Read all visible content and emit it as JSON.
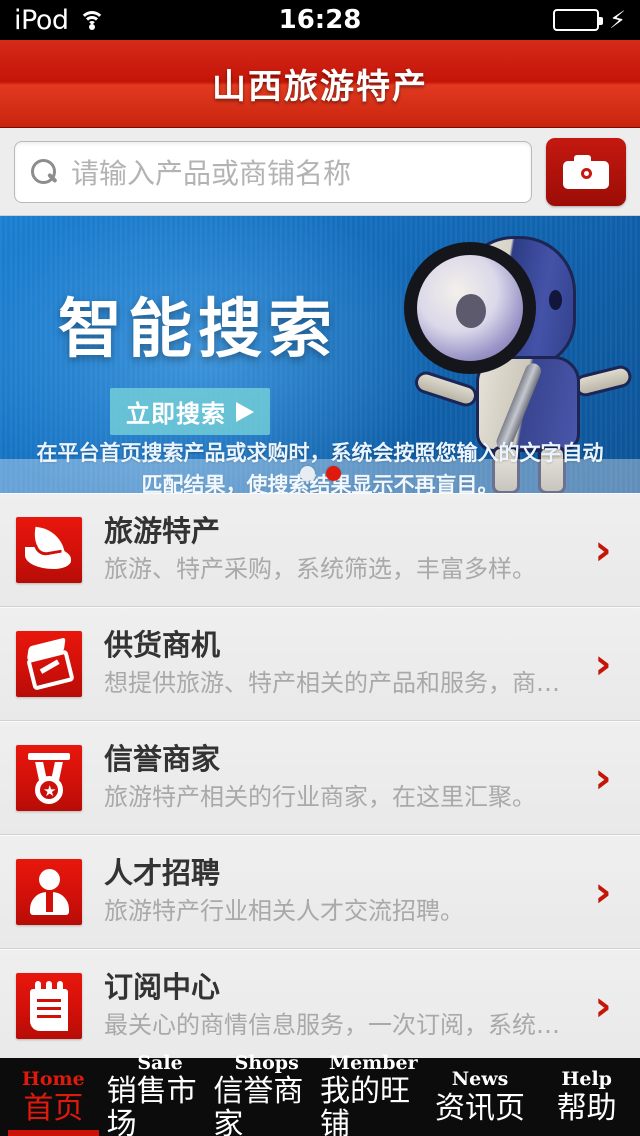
{
  "statusbar": {
    "carrier": "iPod",
    "wifi_icon": "wifi-icon",
    "time": "16:28",
    "battery_icon": "battery-icon",
    "charging_icon": "⚡"
  },
  "header": {
    "title": "山西旅游特产",
    "bg_color": "#c41508"
  },
  "search": {
    "placeholder": "请输入产品或商铺名称",
    "value": "",
    "search_icon": "search-icon",
    "camera_icon": "camera-icon",
    "camera_bg": "#b01009"
  },
  "banner": {
    "title": "智能搜索",
    "button_label": "立即搜索",
    "button_arrow": "➤",
    "description": "在平台首页搜索产品或求购时，系统会按照您输入的文字自动匹配结果，使搜索结果显示不再盲目。",
    "mascot_icon": "robot-magnifier-illustration",
    "dots": [
      {
        "active": false
      },
      {
        "active": true
      }
    ],
    "active_dot_color": "#e0190d"
  },
  "list": {
    "items": [
      {
        "icon": "leaf-icon",
        "title": "旅游特产",
        "subtitle": "旅游、特产采购，系统筛选，丰富多样。",
        "chevron": "›"
      },
      {
        "icon": "box-icon",
        "title": "供货商机",
        "subtitle": "想提供旅游、特产相关的产品和服务，商…",
        "chevron": "›"
      },
      {
        "icon": "medal-icon",
        "title": "信誉商家",
        "subtitle": "旅游特产相关的行业商家，在这里汇聚。",
        "chevron": "›"
      },
      {
        "icon": "user-icon",
        "title": "人才招聘",
        "subtitle": "旅游特产行业相关人才交流招聘。",
        "chevron": "›"
      },
      {
        "icon": "notepad-icon",
        "title": "订阅中心",
        "subtitle": "最关心的商情信息服务，一次订阅，系统…",
        "chevron": "›"
      }
    ]
  },
  "tabbar": {
    "accent_color": "#e0190d",
    "items": [
      {
        "en": "Home",
        "cn": "首页",
        "active": true
      },
      {
        "en": "Sale",
        "cn": "销售市场",
        "active": false
      },
      {
        "en": "Shops",
        "cn": "信誉商家",
        "active": false
      },
      {
        "en": "Member",
        "cn": "我的旺铺",
        "active": false
      },
      {
        "en": "News",
        "cn": "资讯页",
        "active": false
      },
      {
        "en": "Help",
        "cn": "帮助",
        "active": false
      }
    ]
  }
}
